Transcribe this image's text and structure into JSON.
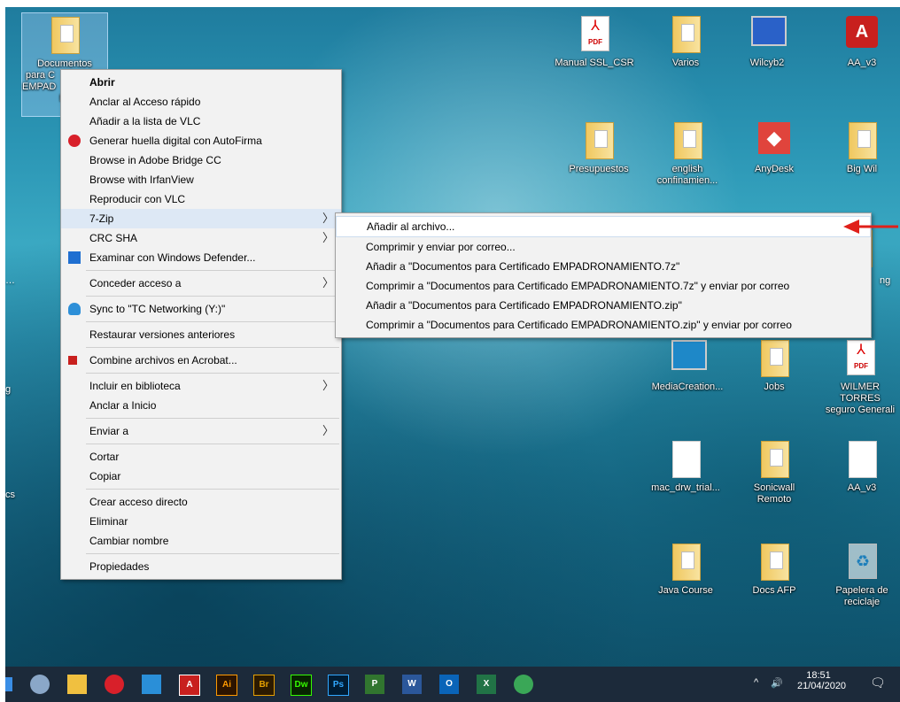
{
  "desktop": {
    "icons": [
      {
        "key": "documentos",
        "l1": "Documentos",
        "l2": "para C",
        "l3": "EMPAD",
        "l4": "N"
      },
      {
        "key": "manual_ssl",
        "label": "Manual SSL_CSR"
      },
      {
        "key": "varios",
        "label": "Varios"
      },
      {
        "key": "wilcyb2",
        "label": "Wilcyb2"
      },
      {
        "key": "aa_v3_top",
        "label": "AA_v3"
      },
      {
        "key": "presupuestos",
        "label": "Presupuestos"
      },
      {
        "key": "english",
        "l1": "english",
        "l2": "confinamien..."
      },
      {
        "key": "anydesk",
        "label": "AnyDesk"
      },
      {
        "key": "bigwil",
        "label": "Big Wil"
      },
      {
        "key": "mediacreation",
        "label": "MediaCreation..."
      },
      {
        "key": "jobs",
        "label": "Jobs"
      },
      {
        "key": "wilmer",
        "l1": "WILMER TORRES",
        "l2": "seguro Generali"
      },
      {
        "key": "macdrw",
        "label": "mac_drw_trial..."
      },
      {
        "key": "sonicwall",
        "l1": "Sonicwall",
        "l2": "Remoto"
      },
      {
        "key": "aa_v3_mid",
        "label": "AA_v3"
      },
      {
        "key": "javacourse",
        "label": "Java Course"
      },
      {
        "key": "docsafp",
        "label": "Docs AFP"
      },
      {
        "key": "papelera",
        "l1": "Papelera de",
        "l2": "reciclaje"
      }
    ],
    "edge_fragments": [
      "g",
      "ng",
      "g",
      "cs"
    ],
    "pdf_badge": "PDF"
  },
  "context_menu": {
    "items": [
      {
        "label": "Abrir",
        "bold": true
      },
      {
        "label": "Anclar al Acceso rápido"
      },
      {
        "label": "Añadir a la lista de VLC"
      },
      {
        "label": "Generar huella digital con AutoFirma",
        "icon": "autofirma-icon"
      },
      {
        "label": "Browse in Adobe Bridge CC"
      },
      {
        "label": "Browse with IrfanView"
      },
      {
        "label": "Reproducir con VLC"
      },
      {
        "label": "7-Zip",
        "submenu": true
      },
      {
        "label": "CRC SHA",
        "submenu": true
      },
      {
        "label": "Examinar con Windows Defender...",
        "icon": "windows-defender-icon"
      },
      {
        "separator": true
      },
      {
        "label": "Conceder acceso a",
        "submenu": true
      },
      {
        "separator": true
      },
      {
        "label": "Sync to \"TC Networking (Y:)\"",
        "icon": "cloud-sync-icon"
      },
      {
        "separator": true
      },
      {
        "label": "Restaurar versiones anteriores"
      },
      {
        "separator": true
      },
      {
        "label": "Combine archivos en Acrobat...",
        "icon": "acrobat-icon"
      },
      {
        "separator": true
      },
      {
        "label": "Incluir en biblioteca",
        "submenu": true
      },
      {
        "label": "Anclar a Inicio"
      },
      {
        "separator": true
      },
      {
        "label": "Enviar a",
        "submenu": true
      },
      {
        "separator": true
      },
      {
        "label": "Cortar"
      },
      {
        "label": "Copiar"
      },
      {
        "separator": true
      },
      {
        "label": "Crear acceso directo"
      },
      {
        "label": "Eliminar"
      },
      {
        "label": "Cambiar nombre"
      },
      {
        "separator": true
      },
      {
        "label": "Propiedades"
      }
    ],
    "submenu_arrow": "〉"
  },
  "zip_submenu": {
    "items": [
      "Añadir al archivo...",
      "Comprimir y enviar por correo...",
      "Añadir a \"Documentos para Certificado EMPADRONAMIENTO.7z\"",
      "Comprimir a \"Documentos para Certificado EMPADRONAMIENTO.7z\" y enviar por correo",
      "Añadir a \"Documentos para Certificado EMPADRONAMIENTO.zip\"",
      "Comprimir a \"Documentos para Certificado EMPADRONAMIENTO.zip\" y enviar por correo"
    ]
  },
  "taskbar": {
    "apps": [
      {
        "name": "tools-icon",
        "txt": ""
      },
      {
        "name": "file-explorer-icon",
        "txt": ""
      },
      {
        "name": "recorder-icon",
        "txt": ""
      },
      {
        "name": "media-icon",
        "txt": ""
      },
      {
        "name": "autocad-icon",
        "txt": "A"
      },
      {
        "name": "illustrator-icon",
        "txt": "Ai"
      },
      {
        "name": "bridge-icon",
        "txt": "Br"
      },
      {
        "name": "dreamweaver-icon",
        "txt": "Dw"
      },
      {
        "name": "photoshop-icon",
        "txt": "Ps"
      },
      {
        "name": "project-icon",
        "txt": "P"
      },
      {
        "name": "word-icon",
        "txt": "W"
      },
      {
        "name": "outlook-icon",
        "txt": "O"
      },
      {
        "name": "excel-icon",
        "txt": "X"
      },
      {
        "name": "chrome-icon",
        "txt": ""
      }
    ],
    "tray": {
      "chevron": "^",
      "volume": "🔊",
      "time": "18:51",
      "date": "21/04/2020",
      "notification": "🗨"
    }
  },
  "colors": {
    "arrow": "#e0201a",
    "illustrator": "#ff9a00",
    "bridge": "#e6a000",
    "dreamweaver": "#35fa00",
    "photoshop": "#31a8ff"
  }
}
